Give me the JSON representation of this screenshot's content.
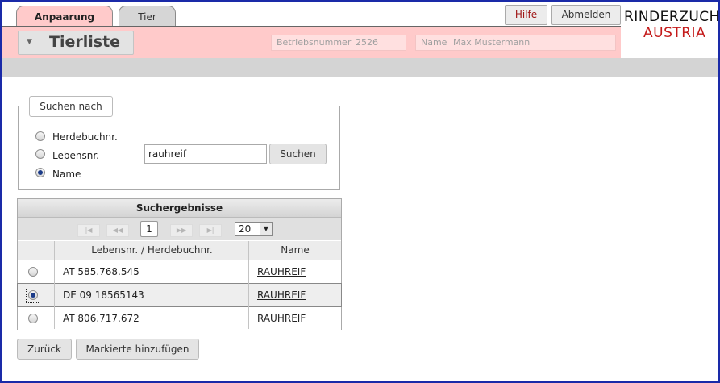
{
  "tabs": [
    {
      "label": "Anpaarung",
      "active": true
    },
    {
      "label": "Tier",
      "active": false
    }
  ],
  "header": {
    "title": "Tierliste",
    "betriebsnummer_label": "Betriebsnummer",
    "betriebsnummer_value": "2526",
    "name_label": "Name",
    "name_value": "Max Mustermann",
    "help_label": "Hilfe",
    "logout_label": "Abmelden",
    "logo_line1": "RINDERZUCHT",
    "logo_line2": "AUSTRIA",
    "brand_red": "#c41a1a",
    "band_color": "#ffcaca"
  },
  "search": {
    "legend": "Suchen nach",
    "options": [
      {
        "label": "Herdebuchnr.",
        "checked": false
      },
      {
        "label": "Lebensnr.",
        "checked": false
      },
      {
        "label": "Name",
        "checked": true
      }
    ],
    "input_value": "rauhreif",
    "button_label": "Suchen"
  },
  "results": {
    "title": "Suchergebnisse",
    "page": "1",
    "page_size": "20",
    "columns": [
      "Lebensnr. / Herdebuchnr.",
      "Name"
    ],
    "rows": [
      {
        "id": "AT 585.768.545",
        "name": "RAUHREIF",
        "selected": false
      },
      {
        "id": "DE 09 18565143",
        "name": "RAUHREIF",
        "selected": true
      },
      {
        "id": "AT 806.717.672",
        "name": "RAUHREIF",
        "selected": false
      }
    ]
  },
  "footer": {
    "back_label": "Zurück",
    "add_label": "Markierte hinzufügen"
  },
  "icons": {
    "menu": "triangle-down-icon",
    "pager_first": "first-page-icon",
    "pager_prev": "prev-page-icon",
    "pager_next": "next-page-icon",
    "pager_last": "last-page-icon",
    "dropdown": "chevron-down-icon"
  }
}
